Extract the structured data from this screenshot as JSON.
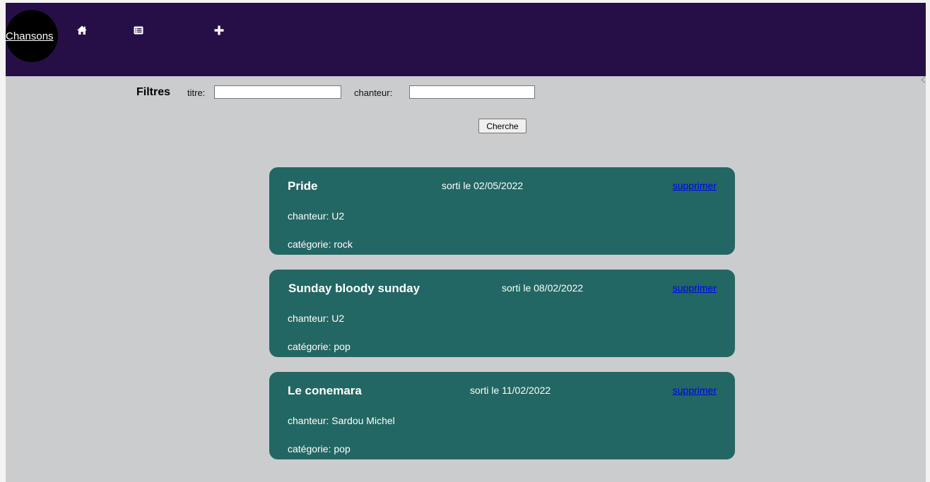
{
  "navbar": {
    "logo_label": "Chansons",
    "icons": [
      "home-icon",
      "list-icon",
      "plus-icon"
    ],
    "background": "#260f46"
  },
  "filters": {
    "title": "Filtres",
    "title_label": "titre:",
    "title_value": "",
    "singer_label": "chanteur:",
    "singer_value": "",
    "search_button": "Cherche"
  },
  "songs": [
    {
      "title": "Pride",
      "date": "sorti le 02/05/2022",
      "delete_label": "supprimer",
      "singer": "chanteur: U2",
      "category": "catégorie: rock"
    },
    {
      "title": "Sunday bloody sunday",
      "date": "sorti le 08/02/2022",
      "delete_label": "supprimer",
      "singer": "chanteur: U2",
      "category": "catégorie: pop"
    },
    {
      "title": "Le conemara",
      "date": "sorti le 11/02/2022",
      "delete_label": "supprimer",
      "singer": "chanteur: Sardou Michel",
      "category": "catégorie: pop"
    }
  ],
  "colors": {
    "card_background": "#226763",
    "page_background": "#cbccce",
    "link": "#0000ee"
  }
}
